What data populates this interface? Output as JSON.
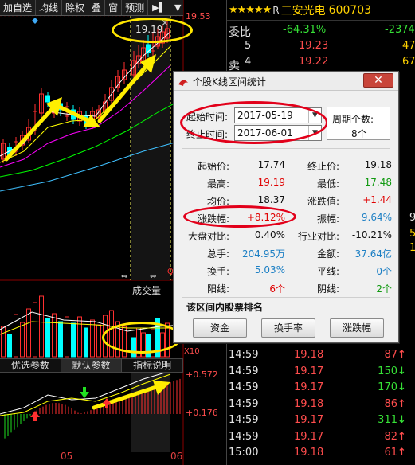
{
  "toolbar": {
    "items": [
      "加自选",
      "均线",
      "除权",
      "叠",
      "窗",
      "预测"
    ]
  },
  "chart": {
    "high_label": "19.53",
    "peak_label": "19.19",
    "q_marker": "Q",
    "volume_label": "成交量",
    "x10_label": "X10",
    "sub_tabs": [
      "优选参数",
      "默认参数",
      "指标说明"
    ],
    "macd_label_top": "+0.572",
    "macd_label_mid": "+0.176",
    "month_left": "05",
    "month_right": "06",
    "colors": {
      "up": "#ff3030",
      "down": "#00ffff",
      "ma1": "#ffffff",
      "ma2": "#ffff00",
      "ma3": "#ff00ff",
      "ma4": "#00ff00"
    }
  },
  "quote": {
    "stars": "★★★★★",
    "r_mark": "R",
    "name": "三安光电",
    "code": "600703",
    "weibi_label": "委比",
    "weibi_pct": "-64.31%",
    "weibi_diff": "-2374",
    "sell_label": "卖",
    "sell_rows": [
      {
        "level": "5",
        "price": "19.23",
        "vol": "47"
      },
      {
        "level": "4",
        "price": "19.22",
        "vol": "67"
      }
    ],
    "side_digits": [
      "9",
      "5",
      "1"
    ],
    "trades": [
      {
        "time": "14:59",
        "price": "19.18",
        "vol": "87",
        "dir": "up"
      },
      {
        "time": "14:59",
        "price": "19.17",
        "vol": "150",
        "dir": "down"
      },
      {
        "time": "14:59",
        "price": "19.17",
        "vol": "170",
        "dir": "down"
      },
      {
        "time": "14:59",
        "price": "19.18",
        "vol": "86",
        "dir": "up"
      },
      {
        "time": "14:59",
        "price": "19.17",
        "vol": "311",
        "dir": "down"
      },
      {
        "time": "14:59",
        "price": "19.17",
        "vol": "82",
        "dir": "up"
      },
      {
        "time": "15:00",
        "price": "19.18",
        "vol": "61",
        "dir": "up"
      }
    ]
  },
  "dialog": {
    "title": "个股K线区间统计",
    "close_glyph": "✕",
    "start_label": "起始时间:",
    "start_value": "2017-05-19",
    "end_label": "终止时间:",
    "end_value": "2017-06-01",
    "period_label": "周期个数:",
    "period_value": "8个",
    "stats": {
      "start_price_label": "起始价:",
      "start_price": "17.74",
      "end_price_label": "终止价:",
      "end_price": "19.18",
      "high_label": "最高:",
      "high": "19.19",
      "low_label": "最低:",
      "low": "17.48",
      "avg_label": "均价:",
      "avg": "18.37",
      "change_label": "涨跌值:",
      "change": "+1.44",
      "change_pct_label": "涨跌幅:",
      "change_pct": "+8.12%",
      "amplitude_label": "振幅:",
      "amplitude": "9.64%",
      "market_label": "大盘对比:",
      "market": "0.40%",
      "industry_label": "行业对比:",
      "industry": "-10.21%",
      "volume_label": "总手:",
      "volume": "204.95万",
      "amount_label": "金额:",
      "amount": "37.64亿",
      "turnover_label": "换手:",
      "turnover": "5.03%",
      "flat_label": "平线:",
      "flat": "0个",
      "yang_label": "阳线:",
      "yang": "6个",
      "yin_label": "阴线:",
      "yin": "2个"
    },
    "rank_title": "该区间内股票排名",
    "buttons": [
      "资金",
      "换手率",
      "涨跌幅"
    ]
  }
}
